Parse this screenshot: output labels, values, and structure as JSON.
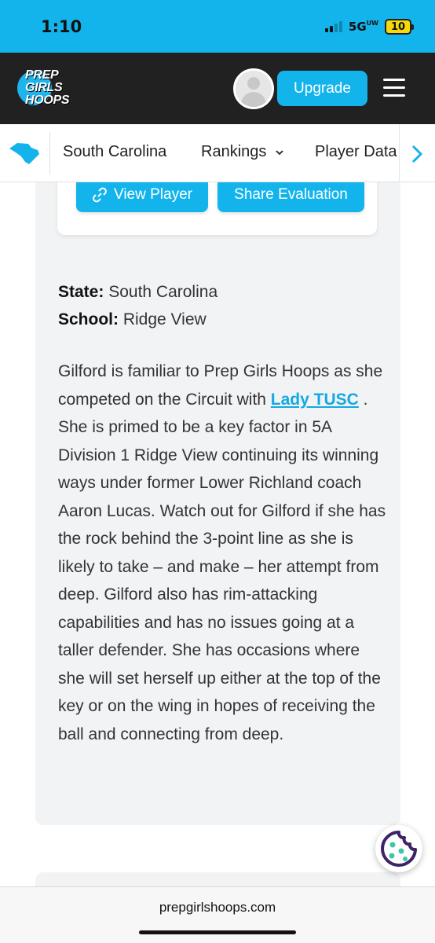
{
  "status_bar": {
    "time": "1:10",
    "network": "5G",
    "network_sub": "UW",
    "battery": "10"
  },
  "header": {
    "logo_lines": [
      "PREP",
      "GIRLS",
      "HOOPS"
    ],
    "upgrade_label": "Upgrade"
  },
  "subnav": {
    "items": [
      "South Carolina",
      "Rankings",
      "Player Data"
    ]
  },
  "player_card": {
    "view_player_label": "View Player",
    "share_label": "Share Evaluation"
  },
  "profile": {
    "state_label": "State:",
    "state_value": "South Carolina",
    "school_label": "School:",
    "school_value": "Ridge View"
  },
  "evaluation": {
    "intro": "Gilford is familiar to Prep Girls Hoops as she competed on the Circuit with ",
    "link_text": "Lady TUSC",
    "body": " . She is primed to be a key factor in 5A Division 1 Ridge View continuing its winning ways under former Lower Richland coach Aaron Lucas. Watch out for Gilford if she has the rock behind the 3-point line as she is likely to take – and make – her attempt from deep. Gilford also has rim-attacking capabilities and has no issues going at a taller defender. She has occasions where she will set herself up either at the top of the key or on the wing in hopes of receiving the ball and connecting from deep."
  },
  "browser": {
    "url": "prepgirlshoops.com"
  },
  "colors": {
    "accent": "#13b4ec",
    "header_bg": "#212121",
    "link": "#13a9e3",
    "cookie": "#3d2466"
  }
}
